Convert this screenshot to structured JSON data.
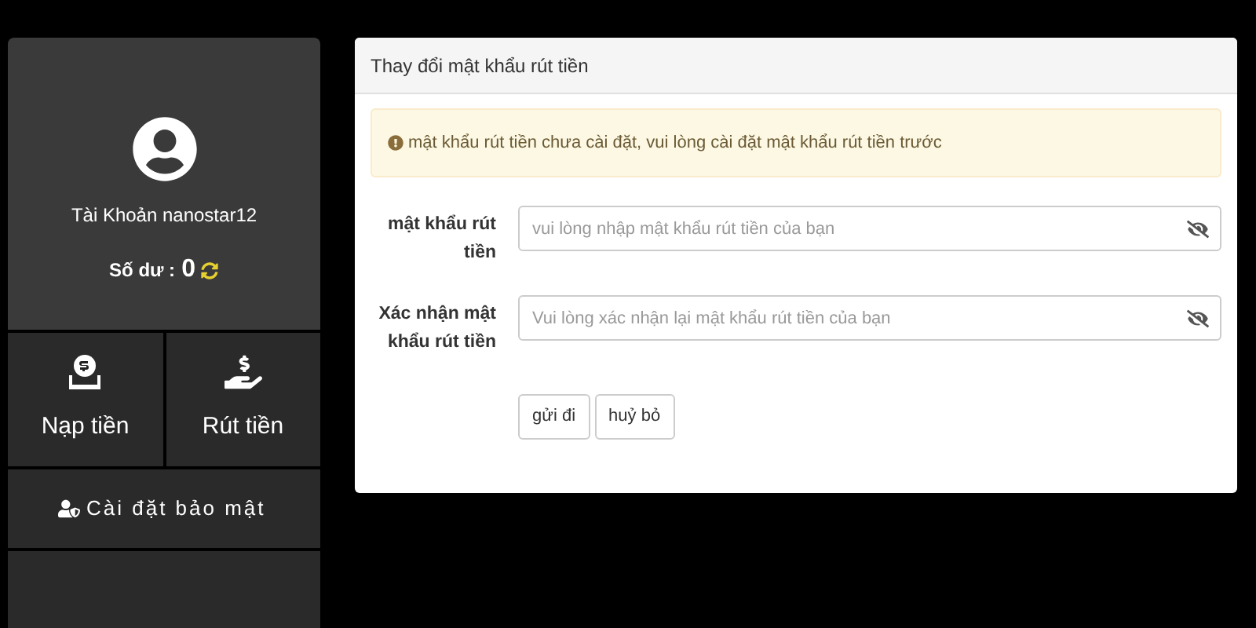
{
  "account": {
    "name": "Tài Khoản nanostar12",
    "balance_label": "Số dư :",
    "balance": "0"
  },
  "actions": [
    {
      "kind": "deposit",
      "label": "Nạp tiền"
    },
    {
      "kind": "withdraw",
      "label": "Rút tiền"
    }
  ],
  "menu": [
    {
      "label": "Cài đặt bảo mật"
    }
  ],
  "form": {
    "title": "Thay đổi mật khẩu rút tiền",
    "alert": "mật khẩu rút tiền chưa cài đặt, vui lòng cài đặt mật khẩu rút tiền trước",
    "fields": [
      {
        "label": "mật khẩu rút tiền",
        "placeholder": "vui lòng nhập mật khẩu rút tiền của bạn"
      },
      {
        "label": "Xác nhận mật khẩu rút tiền",
        "placeholder": "Vui lòng xác nhận lại mật khẩu rút tiền của bạn"
      }
    ],
    "buttons": [
      "gửi đi",
      "huỷ bỏ"
    ]
  }
}
